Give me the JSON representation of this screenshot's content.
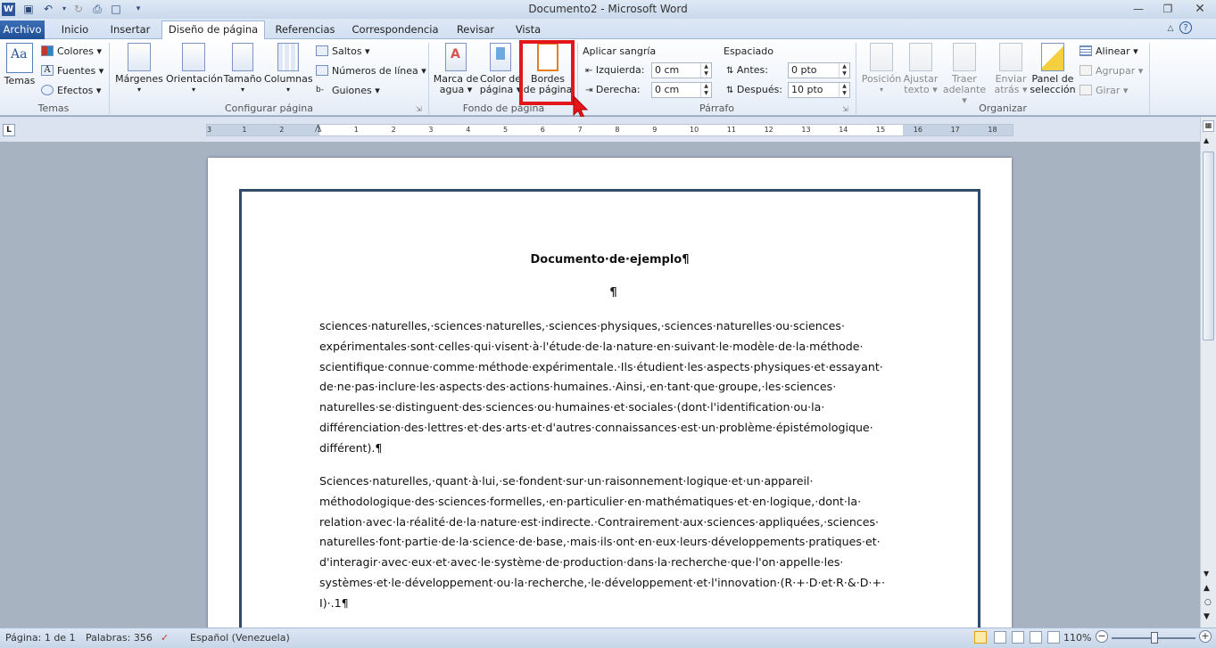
{
  "window": {
    "title": "Documento2 - Microsoft Word"
  },
  "tabs": [
    {
      "label": "Archivo"
    },
    {
      "label": "Inicio"
    },
    {
      "label": "Insertar"
    },
    {
      "label": "Diseño de página"
    },
    {
      "label": "Referencias"
    },
    {
      "label": "Correspondencia"
    },
    {
      "label": "Revisar"
    },
    {
      "label": "Vista"
    }
  ],
  "ribbon": {
    "temas": {
      "label": "Temas",
      "colores": "Colores",
      "fuentes": "Fuentes",
      "efectos": "Efectos",
      "group": "Temas"
    },
    "configurar": {
      "margenes": "Márgenes",
      "orientacion": "Orientación",
      "tamano": "Tamaño",
      "columnas": "Columnas",
      "saltos": "Saltos",
      "numeros": "Números de línea",
      "guiones": "Guiones",
      "group": "Configurar página"
    },
    "fondo": {
      "marca_1": "Marca de",
      "marca_2": "agua",
      "color_1": "Color de",
      "color_2": "página",
      "bordes_1": "Bordes",
      "bordes_2": "de página",
      "group": "Fondo de página"
    },
    "parrafo": {
      "sangria": "Aplicar sangría",
      "izquierda": "Izquierda:",
      "izquierda_val": "0 cm",
      "derecha": "Derecha:",
      "derecha_val": "0 cm",
      "espaciado": "Espaciado",
      "antes": "Antes:",
      "antes_val": "0 pto",
      "despues": "Después:",
      "despues_val": "10 pto",
      "group": "Párrafo"
    },
    "organizar": {
      "posicion": "Posición",
      "ajustar_1": "Ajustar",
      "ajustar_2": "texto",
      "traer_1": "Traer",
      "traer_2": "adelante",
      "enviar_1": "Enviar",
      "enviar_2": "atrás",
      "panel_1": "Panel de",
      "panel_2": "selección",
      "alinear": "Alinear",
      "agrupar": "Agrupar",
      "girar": "Girar",
      "group": "Organizar"
    }
  },
  "ruler": {
    "numbers": [
      "3",
      "1",
      "2",
      "1",
      "1",
      "2",
      "3",
      "4",
      "5",
      "6",
      "7",
      "8",
      "9",
      "10",
      "11",
      "12",
      "13",
      "14",
      "15",
      "16",
      "17",
      "18"
    ]
  },
  "document": {
    "title": "Documento·de·ejemplo¶",
    "empty_para": "¶",
    "paragraph1": "sciences·naturelles,·sciences·naturelles,·sciences·physiques,·sciences·naturelles·ou·sciences· expérimentales·sont·celles·qui·visent·à·l'étude·de·la·nature·en·suivant·le·modèle·de·la·méthode· scientifique·connue·comme·méthode·expérimentale.·Ils·étudient·les·aspects·physiques·et·essayant· de·ne·pas·inclure·les·aspects·des·actions·humaines.·Ainsi,·en·tant·que·groupe,·les·sciences· naturelles·se·distinguent·des·sciences·ou·humaines·et·sociales·(dont·l'identification·ou·la· différenciation·des·lettres·et·des·arts·et·d'autres·connaissances·est·un·problème·épistémologique· différent).¶",
    "paragraph2": "Sciences·naturelles,·quant·à·lui,·se·fondent·sur·un·raisonnement·logique·et·un·appareil· méthodologique·des·sciences·formelles,·en·particulier·en·mathématiques·et·en·logique,·dont·la· relation·avec·la·réalité·de·la·nature·est·indirecte.·Contrairement·aux·sciences·appliquées,·sciences· naturelles·font·partie·de·la·science·de·base,·mais·ils·ont·en·eux·leurs·développements·pratiques·et· d'interagir·avec·eux·et·avec·le·système·de·production·dans·la·recherche·que·l'on·appelle·les· systèmes·et·le·développement·ou·la·recherche,·le·développement·et·l'innovation·(R·+·D·et·R·&·D·+· I)·.1¶"
  },
  "status": {
    "page": "Página: 1 de 1",
    "words": "Palabras: 356",
    "language": "Español (Venezuela)",
    "zoom": "110%"
  },
  "colors": {
    "file_tab": "#2b579a",
    "highlight": "#e3161b",
    "page_border": "#2f4a6b"
  }
}
